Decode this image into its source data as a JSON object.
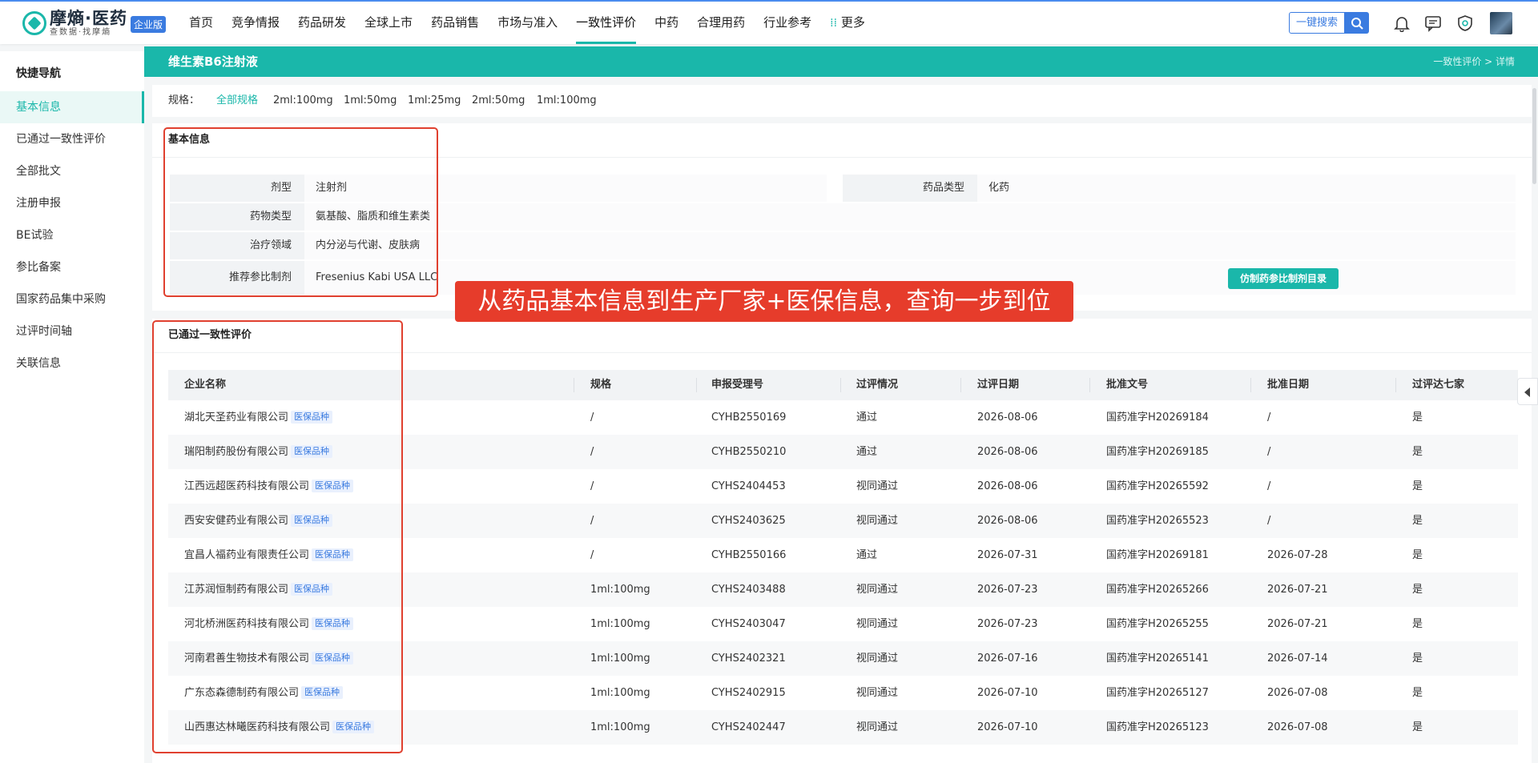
{
  "brand": {
    "name": "摩熵·医药",
    "slogan": "查数据·找摩熵",
    "badge": "企业版"
  },
  "nav": {
    "items": [
      "首页",
      "竞争情报",
      "药品研发",
      "全球上市",
      "药品销售",
      "市场与准入",
      "一致性评价",
      "中药",
      "合理用药",
      "行业参考"
    ],
    "more": "更多",
    "active": "一致性评价",
    "search_label": "一键搜索"
  },
  "sidebar": {
    "title": "快捷导航",
    "items": [
      "基本信息",
      "已通过一致性评价",
      "全部批文",
      "注册申报",
      "BE试验",
      "参比备案",
      "国家药品集中采购",
      "过评时间轴",
      "关联信息"
    ],
    "active": "基本信息"
  },
  "banner": {
    "title": "维生素B6注射液",
    "breadcrumb": "一致性评价 > 详情"
  },
  "spec": {
    "label": "规格：",
    "options": [
      "全部规格",
      "2ml:100mg",
      "1ml:50mg",
      "1ml:25mg",
      "2ml:50mg",
      "1ml:100mg"
    ],
    "active": "全部规格"
  },
  "basic_info": {
    "title": "基本信息",
    "dosage_form_label": "剂型",
    "dosage_form": "注射剂",
    "drug_type_label": "药品类型",
    "drug_type": "化药",
    "drug_class_label": "药物类型",
    "drug_class": "氨基酸、脂质和维生素类",
    "therapeutic_area_label": "治疗领域",
    "therapeutic_area": "内分泌与代谢、皮肤病",
    "ref_preparation_label": "推荐参比制剂",
    "ref_preparation": "Fresenius Kabi USA LLC",
    "ref_button": "仿制药参比制剂目录"
  },
  "overlay_caption": "从药品基本信息到生产厂家+医保信息，查询一步到位",
  "passed": {
    "title": "已通过一致性评价",
    "medicare_tag": "医保品种",
    "columns": [
      "企业名称",
      "规格",
      "申报受理号",
      "过评情况",
      "过评日期",
      "批准文号",
      "批准日期",
      "过评达七家"
    ],
    "rows": [
      {
        "company": "湖北天圣药业有限公司",
        "spec": "/",
        "accept_no": "CYHB2550169",
        "status": "通过",
        "pass_date": "2026-08-06",
        "approval_no": "国药准字H20269184",
        "approval_date": "/",
        "seven": "是"
      },
      {
        "company": "瑞阳制药股份有限公司",
        "spec": "/",
        "accept_no": "CYHB2550210",
        "status": "通过",
        "pass_date": "2026-08-06",
        "approval_no": "国药准字H20269185",
        "approval_date": "/",
        "seven": "是"
      },
      {
        "company": "江西远超医药科技有限公司",
        "spec": "/",
        "accept_no": "CYHS2404453",
        "status": "视同通过",
        "pass_date": "2026-08-06",
        "approval_no": "国药准字H20265592",
        "approval_date": "/",
        "seven": "是"
      },
      {
        "company": "西安安健药业有限公司",
        "spec": "/",
        "accept_no": "CYHS2403625",
        "status": "视同通过",
        "pass_date": "2026-08-06",
        "approval_no": "国药准字H20265523",
        "approval_date": "/",
        "seven": "是"
      },
      {
        "company": "宜昌人福药业有限责任公司",
        "spec": "/",
        "accept_no": "CYHB2550166",
        "status": "通过",
        "pass_date": "2026-07-31",
        "approval_no": "国药准字H20269181",
        "approval_date": "2026-07-28",
        "seven": "是"
      },
      {
        "company": "江苏润恒制药有限公司",
        "spec": "1ml:100mg",
        "accept_no": "CYHS2403488",
        "status": "视同通过",
        "pass_date": "2026-07-23",
        "approval_no": "国药准字H20265266",
        "approval_date": "2026-07-21",
        "seven": "是"
      },
      {
        "company": "河北桥洲医药科技有限公司",
        "spec": "1ml:100mg",
        "accept_no": "CYHS2403047",
        "status": "视同通过",
        "pass_date": "2026-07-23",
        "approval_no": "国药准字H20265255",
        "approval_date": "2026-07-21",
        "seven": "是"
      },
      {
        "company": "河南君善生物技术有限公司",
        "spec": "1ml:100mg",
        "accept_no": "CYHS2402321",
        "status": "视同通过",
        "pass_date": "2026-07-16",
        "approval_no": "国药准字H20265141",
        "approval_date": "2026-07-14",
        "seven": "是"
      },
      {
        "company": "广东态森德制药有限公司",
        "spec": "1ml:100mg",
        "accept_no": "CYHS2402915",
        "status": "视同通过",
        "pass_date": "2026-07-10",
        "approval_no": "国药准字H20265127",
        "approval_date": "2026-07-08",
        "seven": "是"
      },
      {
        "company": "山西惠达林曦医药科技有限公司",
        "spec": "1ml:100mg",
        "accept_no": "CYHS2402447",
        "status": "视同通过",
        "pass_date": "2026-07-10",
        "approval_no": "国药准字H20265123",
        "approval_date": "2026-07-08",
        "seven": "是"
      }
    ]
  },
  "colors": {
    "accent": "#1ab7aa",
    "brand_blue": "#3a7be0",
    "annotation_red": "#e0402f"
  }
}
